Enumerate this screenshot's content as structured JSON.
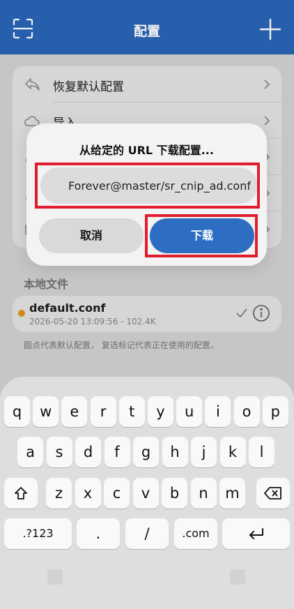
{
  "navbar": {
    "title": "配置",
    "scan_icon": "scan-icon",
    "add_icon": "plus-icon"
  },
  "menu": {
    "items": [
      {
        "label": "恢复默认配置",
        "icon": "undo-icon"
      },
      {
        "label": "导入",
        "icon": "cloud-icon"
      },
      {
        "label": "",
        "icon": "link-icon"
      },
      {
        "label": "",
        "icon": "edit-icon"
      },
      {
        "label": "",
        "icon": "folder-icon"
      }
    ]
  },
  "local_files": {
    "section_title": "本地文件",
    "files": [
      {
        "name": "default.conf",
        "meta": "2026-05-20 13:09:56 - 102.4K",
        "dot_color": "#d08a1a"
      }
    ],
    "footnote": "圆点代表默认配置， 复选标记代表正在使用的配置。"
  },
  "dialog": {
    "title": "从给定的 URL 下载配置...",
    "url_value": "Forever@master/sr_cnip_ad.conf",
    "cancel_label": "取消",
    "download_label": "下载",
    "highlight_color": "#e01d2c",
    "accent_color": "#2d6ec2"
  },
  "keyboard": {
    "row1": [
      "q",
      "w",
      "e",
      "r",
      "t",
      "y",
      "u",
      "i",
      "o",
      "p"
    ],
    "row2": [
      "a",
      "s",
      "d",
      "f",
      "g",
      "h",
      "j",
      "k",
      "l"
    ],
    "row3": [
      "z",
      "x",
      "c",
      "v",
      "b",
      "n",
      "m"
    ],
    "numbers_label": ".?123",
    "dot_label": ".",
    "slash_label": "/",
    "dotcom_label": ".com",
    "shift_icon": "shift-icon",
    "delete_icon": "delete-icon",
    "return_icon": "return-icon"
  },
  "colors": {
    "navbar": "#265fab",
    "highlight": "#e01d2c",
    "accent": "#2d6ec2"
  }
}
